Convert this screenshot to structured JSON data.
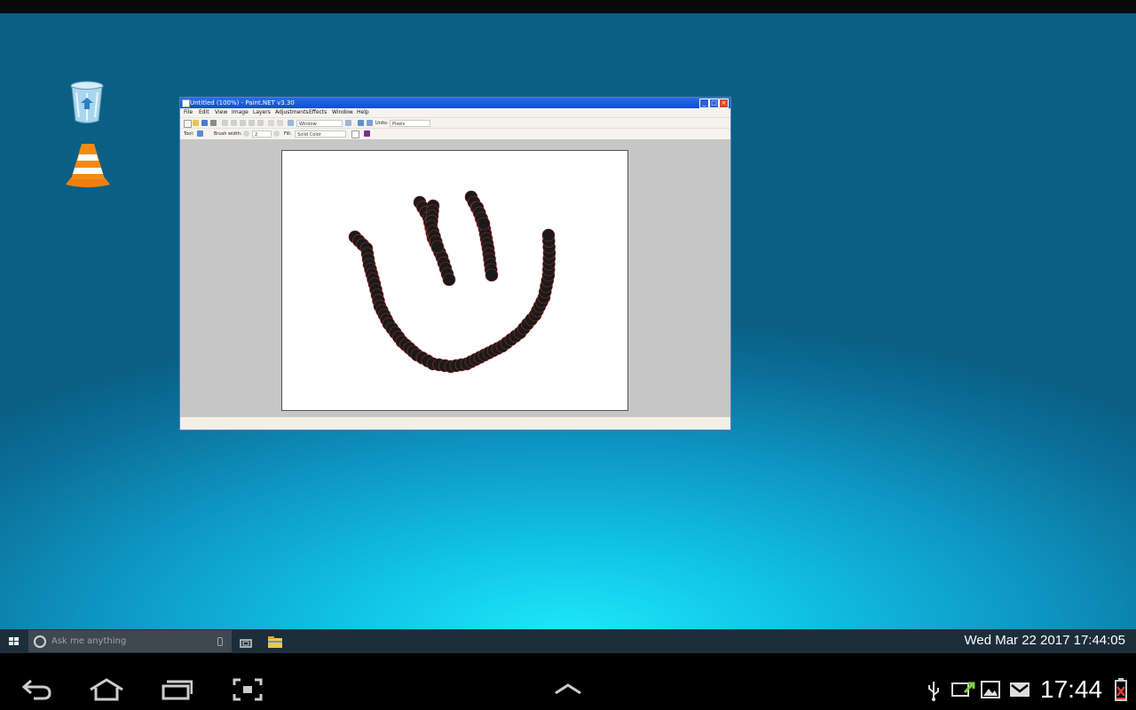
{
  "window": {
    "title": "Untitled (100%) - Paint.NET v3.30",
    "menu": [
      "File",
      "Edit",
      "View",
      "Image",
      "Layers",
      "Adjustments",
      "Effects",
      "Window",
      "Help"
    ],
    "toolbar": {
      "zoom_value": "Window",
      "units_label": "Units:",
      "units_value": "Pixels",
      "tool_label": "Tool:",
      "brush_width_label": "Brush width:",
      "brush_width_value": "2",
      "fill_label": "Fill:",
      "fill_value": "Solid Color"
    }
  },
  "taskbar": {
    "search_placeholder": "Ask me anything",
    "clock": "Wed Mar 22 2017 17:44:05"
  },
  "statusbar": {
    "time": "17:44"
  },
  "icons": {
    "desktop": [
      "recycle-bin-icon",
      "vlc-icon"
    ],
    "android_nav": [
      "back-icon",
      "home-icon",
      "recent-apps-icon",
      "screenshot-icon",
      "up-arrow-icon"
    ],
    "status": [
      "usb-icon",
      "sync-icon",
      "gallery-icon",
      "gmail-icon",
      "battery-icon"
    ]
  },
  "colors": {
    "desktop_accent": "#11c3e6",
    "titlebar": "#0a4fd0",
    "battery_warning": "#e53935",
    "brush": "#1a1a1a"
  }
}
